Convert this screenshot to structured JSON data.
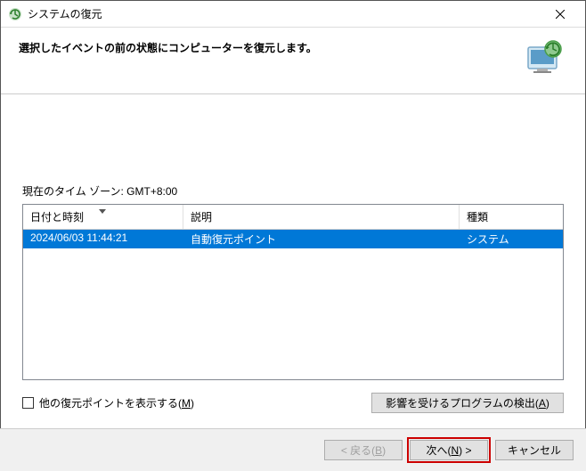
{
  "window": {
    "title": "システムの復元"
  },
  "header": {
    "text": "選択したイベントの前の状態にコンピューターを復元します。"
  },
  "timezone": {
    "label": "現在のタイム ゾーン: GMT+8:00"
  },
  "table": {
    "headers": {
      "datetime": "日付と時刻",
      "description": "説明",
      "type": "種類"
    },
    "rows": [
      {
        "datetime": "2024/06/03 11:44:21",
        "description": "自動復元ポイント",
        "type": "システム"
      }
    ]
  },
  "checkbox": {
    "label_pre": "他の復元ポイントを表示する(",
    "label_key": "M",
    "label_post": ")"
  },
  "detect": {
    "label_pre": "影響を受けるプログラムの検出(",
    "label_key": "A",
    "label_post": ")"
  },
  "footer": {
    "back_pre": "< 戻る(",
    "back_key": "B",
    "back_post": ")",
    "next_pre": "次へ(",
    "next_key": "N",
    "next_post": ") >",
    "cancel": "キャンセル"
  }
}
